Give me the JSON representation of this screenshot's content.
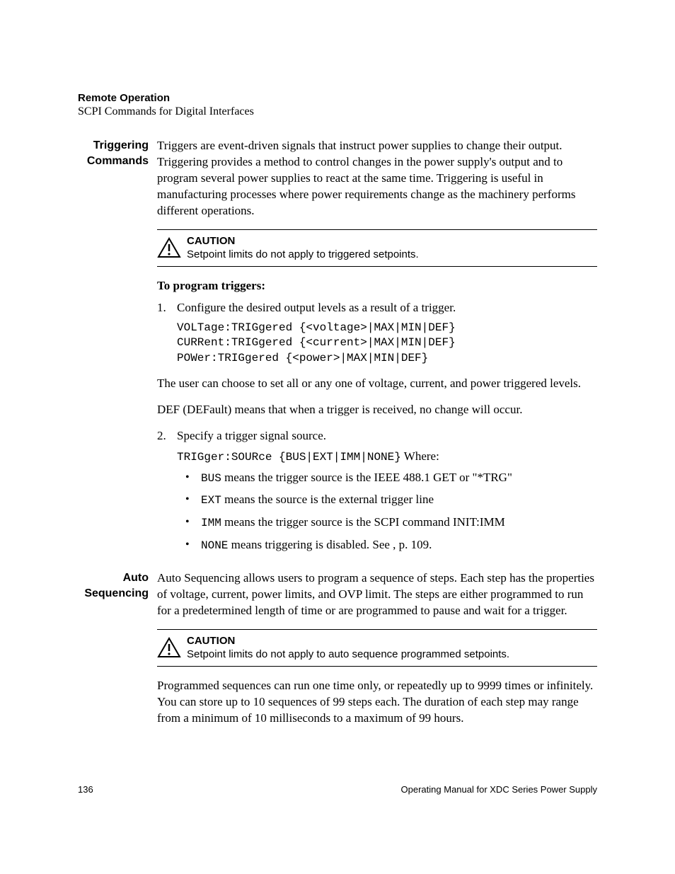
{
  "header": {
    "title": "Remote Operation",
    "subtitle": "SCPI Commands for Digital Interfaces"
  },
  "sections": {
    "triggering": {
      "label_line1": "Triggering",
      "label_line2": "Commands",
      "intro": "Triggers are event-driven signals that instruct power supplies to change their output. Triggering provides a method to control changes in the power supply's output and to program several power supplies to react at the same time. Triggering is useful in manufacturing processes where power requirements change as the machinery performs different operations.",
      "caution_label": "CAUTION",
      "caution_text": "Setpoint limits do not apply to triggered setpoints.",
      "program_heading": "To program triggers:",
      "step1_num": "1.",
      "step1_text": "Configure the desired output levels as a result of a trigger.",
      "code1": "VOLTage:TRIGgered {<voltage>|MAX|MIN|DEF}\nCURRent:TRIGgered {<current>|MAX|MIN|DEF}\nPOWer:TRIGgered {<power>|MAX|MIN|DEF}",
      "after_code1": "The user can choose to set all or any one of voltage, current, and power triggered levels.",
      "def_text": "DEF (DEFault) means that when a trigger is received, no change will occur.",
      "step2_num": "2.",
      "step2_text": "Specify a trigger signal source.",
      "code2": "TRIGger:SOURce {BUS|EXT|IMM|NONE}",
      "code2_suffix": " Where:",
      "bullets": [
        {
          "code": "BUS",
          "text": " means the trigger source is the IEEE 488.1 GET or \"*TRG\""
        },
        {
          "code": "EXT",
          "text": " means the source is the external trigger line"
        },
        {
          "code": "IMM",
          "text": " means the trigger source is the SCPI command INIT:IMM"
        },
        {
          "code": "NONE",
          "text": " means triggering is disabled. See  , p. 109."
        }
      ]
    },
    "auto": {
      "label_line1": "Auto",
      "label_line2": "Sequencing",
      "intro": "Auto Sequencing allows users to program a sequence of steps. Each step has the properties of voltage, current, power limits, and OVP limit. The steps are either programmed to run for a predetermined length of time or are programmed to pause and wait for a trigger.",
      "caution_label": "CAUTION",
      "caution_text": "Setpoint limits do not apply to auto sequence programmed setpoints.",
      "after": "Programmed sequences can run one time only, or repeatedly up to 9999 times or infinitely. You can store up to 10 sequences of 99 steps each. The duration of each step may range from a minimum of 10 milliseconds to a maximum of 99 hours."
    }
  },
  "footer": {
    "page": "136",
    "title": "Operating Manual for XDC Series Power Supply"
  }
}
